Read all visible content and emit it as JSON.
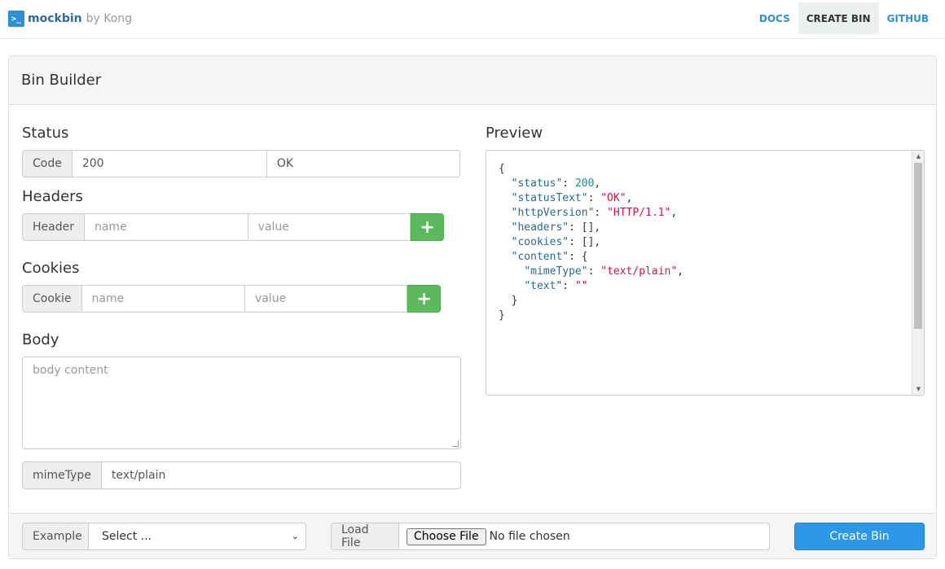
{
  "brand": {
    "name": "mockbin",
    "by": "by Kong",
    "logo_glyph": ">_"
  },
  "nav": {
    "items": [
      {
        "label": "DOCS"
      },
      {
        "label": "CREATE BIN"
      },
      {
        "label": "GITHUB"
      }
    ]
  },
  "panel": {
    "title": "Bin Builder"
  },
  "status": {
    "heading": "Status",
    "addon": "Code",
    "code": "200",
    "text": "OK"
  },
  "headers": {
    "heading": "Headers",
    "addon": "Header",
    "name_placeholder": "name",
    "value_placeholder": "value",
    "add_glyph": "+"
  },
  "cookies": {
    "heading": "Cookies",
    "addon": "Cookie",
    "name_placeholder": "name",
    "value_placeholder": "value",
    "add_glyph": "+"
  },
  "body": {
    "heading": "Body",
    "placeholder": "body content",
    "mime_addon": "mimeType",
    "mime_value": "text/plain"
  },
  "preview": {
    "heading": "Preview",
    "json": {
      "status_key": "\"status\"",
      "status_val": "200",
      "statusText_key": "\"statusText\"",
      "statusText_val": "\"OK\"",
      "httpVersion_key": "\"httpVersion\"",
      "httpVersion_val": "\"HTTP/1.1\"",
      "headers_key": "\"headers\"",
      "headers_val": "[]",
      "cookies_key": "\"cookies\"",
      "cookies_val": "[]",
      "content_key": "\"content\"",
      "mimeType_key": "\"mimeType\"",
      "mimeType_val": "\"text/plain\"",
      "text_key": "\"text\"",
      "text_val": "\"\""
    }
  },
  "footer": {
    "example_addon": "Example",
    "example_selected": "Select ...",
    "load_addon": "Load File",
    "choose_label": "Choose File",
    "file_status": "No file chosen",
    "create_label": "Create Bin"
  },
  "colors": {
    "accent": "#2d97e8",
    "success": "#5cb85c",
    "brand": "#2a6aa1"
  }
}
